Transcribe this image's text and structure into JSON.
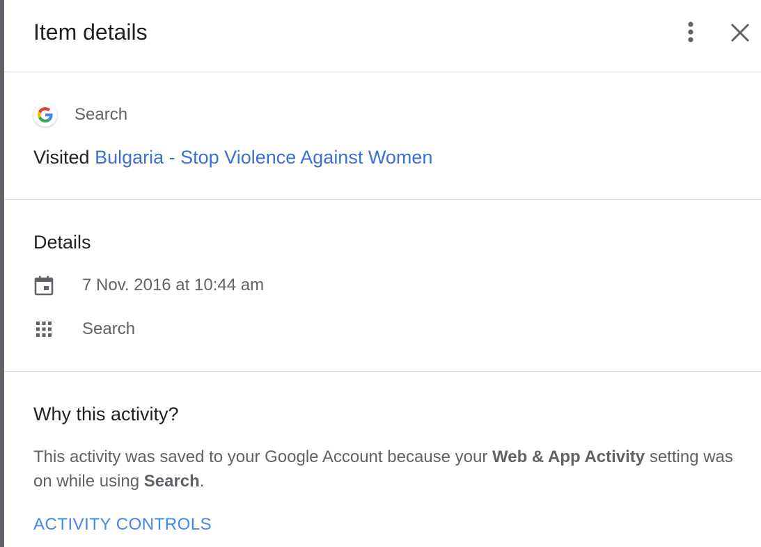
{
  "header": {
    "title": "Item details",
    "more_icon": "more-vert-icon",
    "close_icon": "close-icon"
  },
  "item": {
    "product_icon": "google-g-logo",
    "product_name": "Search",
    "visited_prefix": "Visited",
    "visited_link": "Bulgaria - Stop Violence Against Women"
  },
  "details": {
    "heading": "Details",
    "date_icon": "calendar-icon",
    "date": "7 Nov. 2016 at 10:44 am",
    "app_icon": "apps-grid-icon",
    "app": "Search"
  },
  "why": {
    "heading": "Why this activity?",
    "text_part1": "This activity was saved to your Google Account because your ",
    "text_bold1": "Web & App Activity",
    "text_part2": " setting was on while using ",
    "text_bold2": "Search",
    "text_part3": ".",
    "controls_label": "ACTIVITY CONTROLS"
  },
  "colors": {
    "link": "#3c6fd6",
    "accent": "#4285f4",
    "divider": "#dadce0",
    "text_primary": "#202124",
    "text_secondary": "#5f6368"
  }
}
